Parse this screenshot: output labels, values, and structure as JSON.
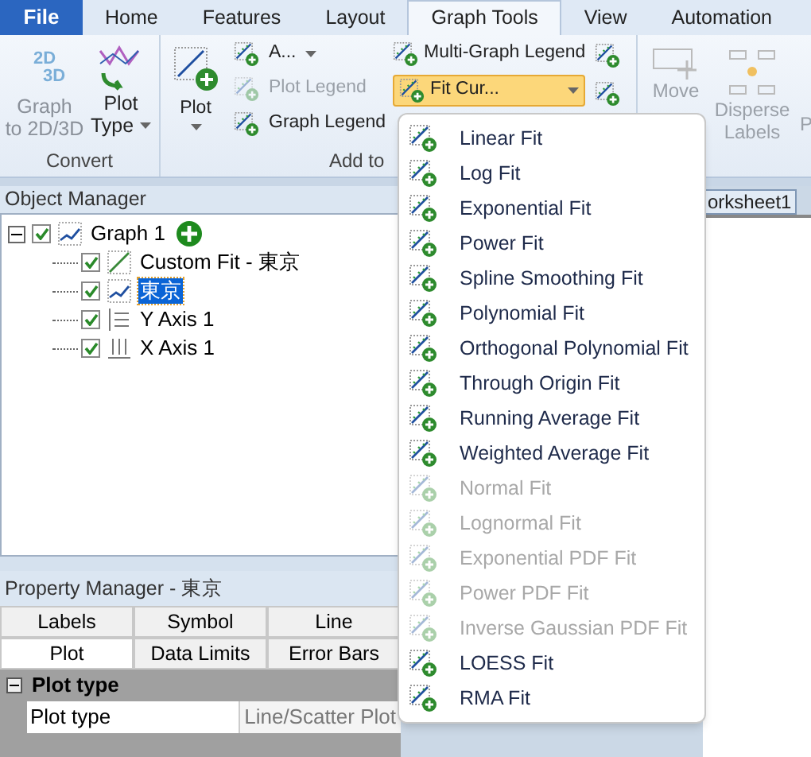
{
  "tabs": [
    {
      "label": "File",
      "kind": "file",
      "selected": false
    },
    {
      "label": "Home",
      "kind": "tab",
      "selected": false
    },
    {
      "label": "Features",
      "kind": "tab",
      "selected": false
    },
    {
      "label": "Layout",
      "kind": "tab",
      "selected": false
    },
    {
      "label": "Graph Tools",
      "kind": "tab",
      "selected": true
    },
    {
      "label": "View",
      "kind": "tab",
      "selected": false
    },
    {
      "label": "Automation",
      "kind": "tab",
      "selected": false
    }
  ],
  "ribbon": {
    "convert": {
      "label": "Convert",
      "graph_to": {
        "lines": [
          "Graph",
          "to 2D/3D"
        ],
        "disabled": true,
        "icon_text": [
          "2D",
          "3D"
        ]
      },
      "plot_type": {
        "lines": [
          "Plot",
          "Type"
        ]
      }
    },
    "add_to": {
      "label": "Add to",
      "plot": "Plot",
      "small": [
        {
          "label": "A...",
          "disabled": false,
          "dropdown": true
        },
        {
          "label": "Plot Legend",
          "disabled": true,
          "dropdown": false
        },
        {
          "label": "Graph Legend",
          "disabled": false,
          "dropdown": false
        }
      ],
      "multi_graph_legend": "Multi-Graph Legend",
      "fit_curve": "Fit Cur..."
    },
    "arrange": {
      "move": "Move",
      "disperse": [
        "Disperse",
        "Labels"
      ],
      "cut_label": "P"
    }
  },
  "object_manager": {
    "title": "Object Manager",
    "tree": [
      {
        "label": "Graph 1",
        "kind": "graph",
        "checked": true,
        "expanded": true,
        "selected": false,
        "children": [
          {
            "label": "Custom Fit - 東京",
            "kind": "fit",
            "checked": true,
            "selected": false
          },
          {
            "label": "東京",
            "kind": "plot",
            "checked": true,
            "selected": true
          },
          {
            "label": "Y Axis 1",
            "kind": "yaxis",
            "checked": true,
            "selected": false
          },
          {
            "label": "X Axis 1",
            "kind": "xaxis",
            "checked": true,
            "selected": false
          }
        ]
      }
    ]
  },
  "worksheet_tab": {
    "label": "orksheet1"
  },
  "property_manager": {
    "title": "Property Manager - 東京",
    "tab_rows": [
      [
        {
          "label": "Labels",
          "selected": false
        },
        {
          "label": "Symbol",
          "selected": false
        },
        {
          "label": "Line",
          "selected": false
        }
      ],
      [
        {
          "label": "Plot",
          "selected": true
        },
        {
          "label": "Data Limits",
          "selected": false
        },
        {
          "label": "Error Bars",
          "selected": false
        }
      ]
    ],
    "sections": [
      {
        "title": "Plot type",
        "expanded": true,
        "rows": [
          {
            "name": "Plot type",
            "value": "Line/Scatter Plot"
          }
        ]
      }
    ]
  },
  "fit_menu": {
    "items": [
      {
        "label": "Linear Fit",
        "disabled": false
      },
      {
        "label": "Log Fit",
        "disabled": false
      },
      {
        "label": "Exponential Fit",
        "disabled": false
      },
      {
        "label": "Power Fit",
        "disabled": false
      },
      {
        "label": "Spline Smoothing Fit",
        "disabled": false
      },
      {
        "label": "Polynomial Fit",
        "disabled": false
      },
      {
        "label": "Orthogonal Polynomial Fit",
        "disabled": false
      },
      {
        "label": "Through Origin Fit",
        "disabled": false
      },
      {
        "label": "Running Average Fit",
        "disabled": false
      },
      {
        "label": "Weighted Average Fit",
        "disabled": false
      },
      {
        "label": "Normal Fit",
        "disabled": true
      },
      {
        "label": "Lognormal Fit",
        "disabled": true
      },
      {
        "label": "Exponential PDF Fit",
        "disabled": true
      },
      {
        "label": "Power PDF Fit",
        "disabled": true
      },
      {
        "label": "Inverse Gaussian PDF Fit",
        "disabled": true
      },
      {
        "label": "LOESS Fit",
        "disabled": false
      },
      {
        "label": "RMA Fit",
        "disabled": false
      }
    ]
  }
}
